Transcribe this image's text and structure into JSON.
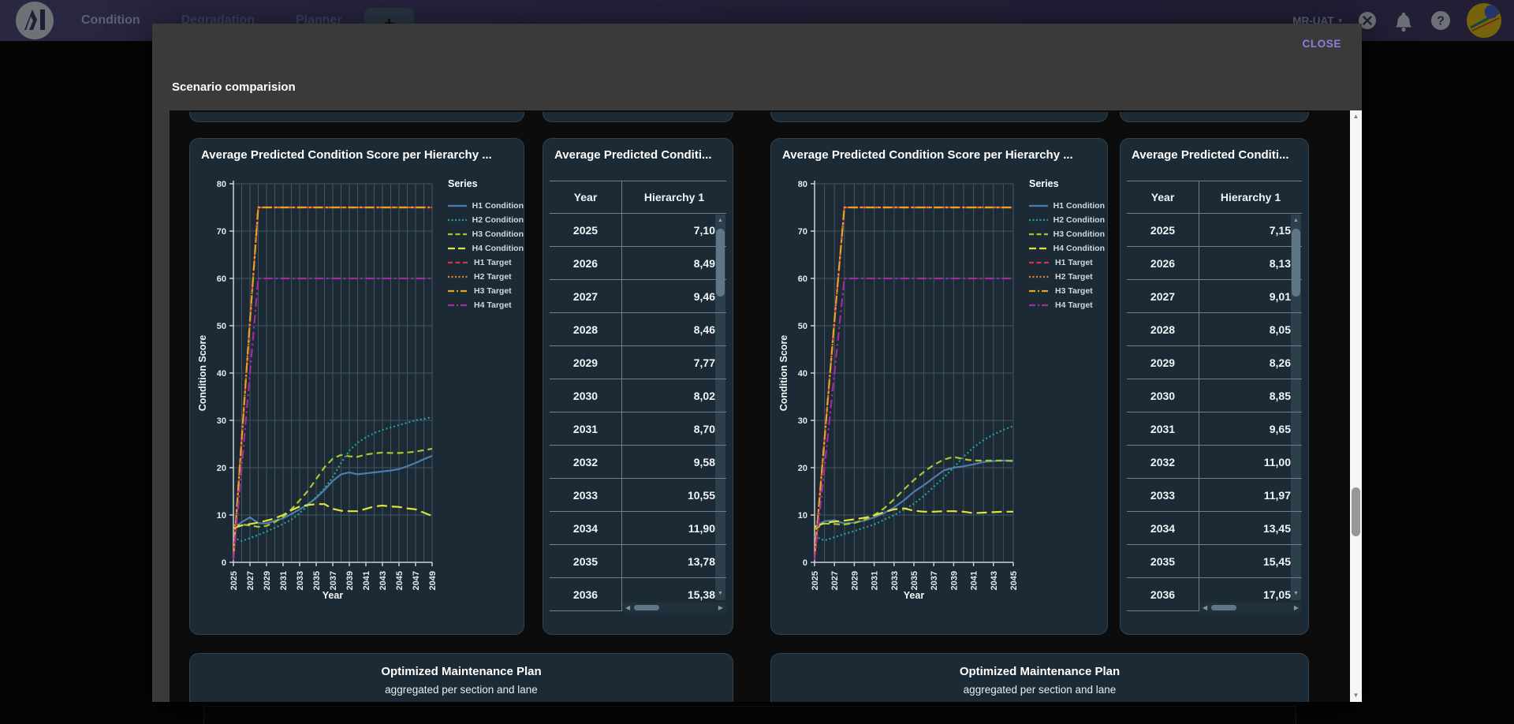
{
  "navbar": {
    "tabs": [
      {
        "label": "Condition",
        "active": true
      },
      {
        "label": "Degradation",
        "active": false
      },
      {
        "label": "Planner",
        "active": false
      }
    ],
    "new_tab_label": "+",
    "user_label": "MR-UAT",
    "icons": [
      "logo-icon",
      "account-icon",
      "notifications-bell-icon",
      "help-icon",
      "avatar"
    ]
  },
  "modal": {
    "title": "Scenario comparision",
    "close_label": "CLOSE"
  },
  "theme": {
    "navbar_purple": "#3c3861",
    "modal_gray": "#3a3a3a",
    "content_black": "#0c0c0c",
    "card_bg": "#1b2a35",
    "card_border": "#31424e",
    "close_accent": "#8b80e2",
    "grid_color": "#45555f",
    "axis_color": "#c9d1d5"
  },
  "scenarios": [
    {
      "table": {
        "title": "Average Predicted Conditi...",
        "columns": [
          "Year",
          "Hierarchy 1"
        ],
        "rows": [
          [
            "2025",
            "7,10"
          ],
          [
            "2026",
            "8,49"
          ],
          [
            "2027",
            "9,46"
          ],
          [
            "2028",
            "8,46"
          ],
          [
            "2029",
            "7,77"
          ],
          [
            "2030",
            "8,02"
          ],
          [
            "2031",
            "8,70"
          ],
          [
            "2032",
            "9,58"
          ],
          [
            "2033",
            "10,55"
          ],
          [
            "2034",
            "11,90"
          ],
          [
            "2035",
            "13,78"
          ],
          [
            "2036",
            "15,38"
          ]
        ]
      },
      "plan": {
        "title": "Optimized Maintenance Plan",
        "subtitle": "aggregated per section and lane"
      }
    },
    {
      "table": {
        "title": "Average Predicted Conditi...",
        "columns": [
          "Year",
          "Hierarchy 1"
        ],
        "rows": [
          [
            "2025",
            "7,15"
          ],
          [
            "2026",
            "8,13"
          ],
          [
            "2027",
            "9,01"
          ],
          [
            "2028",
            "8,05"
          ],
          [
            "2029",
            "8,26"
          ],
          [
            "2030",
            "8,85"
          ],
          [
            "2031",
            "9,65"
          ],
          [
            "2032",
            "11,00"
          ],
          [
            "2033",
            "11,97"
          ],
          [
            "2034",
            "13,45"
          ],
          [
            "2035",
            "15,45"
          ],
          [
            "2036",
            "17,05"
          ]
        ]
      },
      "plan": {
        "title": "Optimized Maintenance Plan",
        "subtitle": "aggregated per section and lane"
      }
    }
  ],
  "chart_data": [
    {
      "type": "line",
      "title": "Average Predicted Condition Score per Hierarchy ...",
      "xlabel": "Year",
      "ylabel": "Condition Score",
      "ylim": [
        0,
        80
      ],
      "grid": true,
      "legend_position": "right",
      "legend_title": "Series",
      "x": [
        2025,
        2026,
        2027,
        2028,
        2029,
        2030,
        2031,
        2032,
        2033,
        2034,
        2035,
        2036,
        2037,
        2038,
        2039,
        2040,
        2041,
        2042,
        2043,
        2044,
        2045,
        2046,
        2047,
        2048,
        2049
      ],
      "series": [
        {
          "name": "H1 Condition",
          "color": "#4e7dad",
          "style": "solid",
          "values": [
            7.0,
            8.5,
            9.5,
            8.3,
            8.2,
            8.8,
            9.3,
            10.2,
            11.2,
            12.3,
            13.6,
            15.3,
            17.2,
            18.6,
            19.0,
            18.6,
            18.8,
            19.0,
            19.2,
            19.4,
            19.7,
            20.3,
            21.0,
            21.8,
            22.5
          ]
        },
        {
          "name": "H2 Condition",
          "color": "#29a296",
          "style": "dotted",
          "values": [
            5.2,
            4.5,
            5.1,
            5.8,
            6.5,
            7.3,
            8.1,
            9.0,
            10.4,
            12.0,
            13.8,
            15.6,
            18.0,
            21.0,
            23.6,
            25.3,
            26.4,
            27.3,
            28.0,
            28.5,
            29.0,
            29.5,
            30.0,
            30.3,
            30.7
          ]
        },
        {
          "name": "H3 Condition",
          "color": "#a3c832",
          "style": "dashed",
          "values": [
            7.8,
            8.0,
            7.8,
            7.5,
            7.7,
            8.5,
            9.6,
            11.2,
            13.1,
            15.1,
            17.6,
            20.1,
            21.9,
            22.7,
            22.4,
            22.3,
            22.8,
            23.0,
            23.2,
            23.1,
            23.1,
            23.2,
            23.4,
            23.7,
            24.0
          ]
        },
        {
          "name": "H4 Condition",
          "color": "#e5e141",
          "style": "longdash",
          "values": [
            7.2,
            7.8,
            8.1,
            8.4,
            8.8,
            9.3,
            10.0,
            11.0,
            11.8,
            12.1,
            12.3,
            12.3,
            11.3,
            10.9,
            10.8,
            10.8,
            11.3,
            11.8,
            12.0,
            11.8,
            11.7,
            11.4,
            11.2,
            10.5,
            9.8
          ]
        },
        {
          "name": "H1 Target",
          "color": "#d2344e",
          "style": "dashed",
          "values": [
            1,
            26,
            51,
            75,
            75,
            75,
            75,
            75,
            75,
            75,
            75,
            75,
            75,
            75,
            75,
            75,
            75,
            75,
            75,
            75,
            75,
            75,
            75,
            75,
            75
          ]
        },
        {
          "name": "H2 Target",
          "color": "#e5862b",
          "style": "dotted",
          "values": [
            1,
            26,
            51,
            75,
            75,
            75,
            75,
            75,
            75,
            75,
            75,
            75,
            75,
            75,
            75,
            75,
            75,
            75,
            75,
            75,
            75,
            75,
            75,
            75,
            75
          ]
        },
        {
          "name": "H3 Target",
          "color": "#e5a41f",
          "style": "dashdot",
          "values": [
            1,
            26,
            51,
            75,
            75,
            75,
            75,
            75,
            75,
            75,
            75,
            75,
            75,
            75,
            75,
            75,
            75,
            75,
            75,
            75,
            75,
            75,
            75,
            75,
            75
          ]
        },
        {
          "name": "H4 Target",
          "color": "#a62ba0",
          "style": "dashdot",
          "values": [
            0.5,
            20,
            40,
            60,
            60,
            60,
            60,
            60,
            60,
            60,
            60,
            60,
            60,
            60,
            60,
            60,
            60,
            60,
            60,
            60,
            60,
            60,
            60,
            60,
            60
          ]
        }
      ]
    },
    {
      "type": "line",
      "title": "Average Predicted Condition Score per Hierarchy ...",
      "xlabel": "Year",
      "ylabel": "Condition Score",
      "ylim": [
        0,
        80
      ],
      "grid": true,
      "legend_position": "right",
      "legend_title": "Series",
      "x": [
        2025,
        2026,
        2027,
        2028,
        2029,
        2030,
        2031,
        2032,
        2033,
        2034,
        2035,
        2036,
        2037,
        2038,
        2039,
        2040,
        2041,
        2042,
        2043,
        2044,
        2045
      ],
      "series": [
        {
          "name": "H1 Condition",
          "color": "#4e7dad",
          "style": "solid",
          "values": [
            7.5,
            8.7,
            8.9,
            8.2,
            8.4,
            8.8,
            9.5,
            10.4,
            11.6,
            13.1,
            14.9,
            16.3,
            17.9,
            19.4,
            20.0,
            20.3,
            20.7,
            21.2,
            21.4,
            21.5,
            21.5
          ]
        },
        {
          "name": "H2 Condition",
          "color": "#29a296",
          "style": "dotted",
          "values": [
            5.5,
            4.6,
            5.3,
            6.0,
            6.6,
            7.3,
            8.0,
            9.0,
            10.0,
            11.1,
            12.4,
            14.0,
            16.0,
            17.9,
            20.0,
            22.3,
            24.3,
            25.8,
            27.0,
            28.0,
            28.8
          ]
        },
        {
          "name": "H3 Condition",
          "color": "#a3c832",
          "style": "dashed",
          "values": [
            7.0,
            8.2,
            8.1,
            8.0,
            8.3,
            9.0,
            10.0,
            11.4,
            13.3,
            15.4,
            17.4,
            19.1,
            20.6,
            21.7,
            22.3,
            21.8,
            21.5,
            21.5,
            21.5,
            21.5,
            21.4
          ]
        },
        {
          "name": "H4 Condition",
          "color": "#e5e141",
          "style": "longdash",
          "values": [
            7.5,
            8.3,
            8.6,
            8.8,
            9.1,
            9.4,
            9.9,
            10.6,
            11.2,
            11.4,
            10.9,
            10.7,
            10.7,
            10.8,
            10.8,
            10.7,
            10.4,
            10.5,
            10.6,
            10.7,
            10.7
          ]
        },
        {
          "name": "H1 Target",
          "color": "#d2344e",
          "style": "dashed",
          "values": [
            1,
            26,
            51,
            75,
            75,
            75,
            75,
            75,
            75,
            75,
            75,
            75,
            75,
            75,
            75,
            75,
            75,
            75,
            75,
            75,
            75
          ]
        },
        {
          "name": "H2 Target",
          "color": "#e5862b",
          "style": "dotted",
          "values": [
            1,
            26,
            51,
            75,
            75,
            75,
            75,
            75,
            75,
            75,
            75,
            75,
            75,
            75,
            75,
            75,
            75,
            75,
            75,
            75,
            75
          ]
        },
        {
          "name": "H3 Target",
          "color": "#e5a41f",
          "style": "dashdot",
          "values": [
            1,
            26,
            51,
            75,
            75,
            75,
            75,
            75,
            75,
            75,
            75,
            75,
            75,
            75,
            75,
            75,
            75,
            75,
            75,
            75,
            75
          ]
        },
        {
          "name": "H4 Target",
          "color": "#a62ba0",
          "style": "dashdot",
          "values": [
            0.5,
            20,
            40,
            60,
            60,
            60,
            60,
            60,
            60,
            60,
            60,
            60,
            60,
            60,
            60,
            60,
            60,
            60,
            60,
            60,
            60
          ]
        }
      ]
    }
  ]
}
